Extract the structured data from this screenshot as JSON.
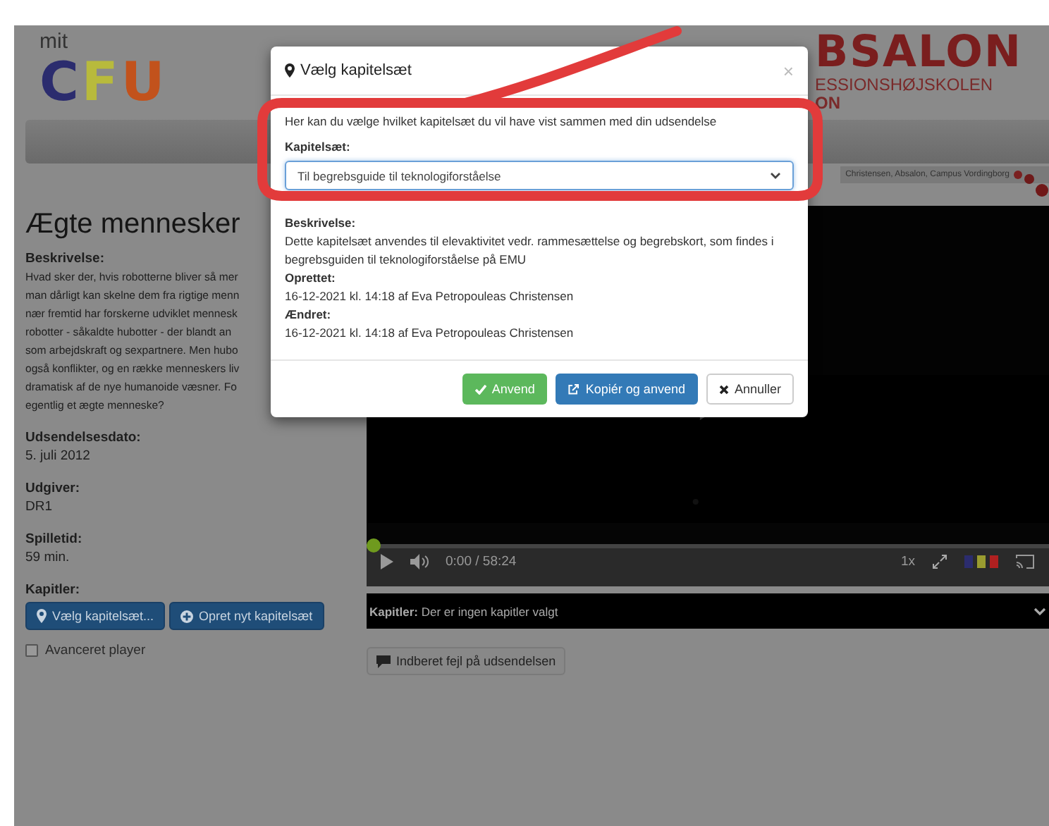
{
  "header": {
    "logo_prefix": "mit",
    "logo": "CFU",
    "school_logo": "BSALON",
    "school_name": "ESSIONSHØJSKOLEN",
    "school_name_2": "ON",
    "breadcrumb": "Christensen, Absalon, Campus Vordingborg"
  },
  "program": {
    "title": "Ægte mennesker",
    "description_label": "Beskrivelse:",
    "description_lines": [
      "Hvad sker der, hvis robotterne bliver så mer",
      "man dårligt kan skelne dem fra rigtige menn",
      "nær fremtid har forskerne udviklet mennesk",
      "robotter - såkaldte hubotter - der blandt an",
      "som arbejdskraft og sexpartnere. Men hubo",
      "også konflikter, og en række menneskers liv",
      "dramatisk af de nye humanoide væsner. Fo",
      "egentlig et ægte menneske?"
    ],
    "fields": [
      {
        "label": "Udsendelsesdato:",
        "value": "5. juli 2012"
      },
      {
        "label": "Udgiver:",
        "value": "DR1"
      },
      {
        "label": "Spilletid:",
        "value": "59 min."
      }
    ],
    "chapters_label": "Kapitler:",
    "chapter_buttons": [
      {
        "label": "Vælg kapitelsæt..."
      },
      {
        "label": "Opret nyt kapitelsæt"
      }
    ],
    "advanced_player": {
      "label": "Avanceret player",
      "checked": false
    }
  },
  "player": {
    "level": 0,
    "time": "0:00 / 58:24",
    "speed": "1x",
    "chapters_bar": "**Kapitler:** Der er ingen kapitler valgt",
    "report_button": "Indberet fejl på udsendelsen"
  },
  "dialog": {
    "title": "Vælg kapitelsæt",
    "close": "×",
    "intro": "Her kan du vælge hvilket kapitelsæt du vil have vist sammen med din udsendelse",
    "select_label": "Kapitelsæt:",
    "select_value": "Til begrebsguide til teknologiforståelse",
    "details": [
      {
        "label": "Beskrivelse:",
        "value": "Dette kapitelsæt anvendes til elevaktivitet vedr. rammesættelse og begrebskort, som findes i begrebsguiden til teknologiforståelse på EMU"
      },
      {
        "label": "Oprettet:",
        "value": "16-12-2021 kl. 14:18 af Eva Petropouleas Christensen"
      },
      {
        "label": "Ændret:",
        "value": "16-12-2021 kl. 14:18 af Eva Petropouleas Christensen"
      }
    ],
    "buttons": [
      {
        "label": "Anvend",
        "kind": "success"
      },
      {
        "label": "Kopiér og anvend",
        "kind": "primary"
      },
      {
        "label": "Annuller",
        "kind": "default"
      }
    ]
  }
}
